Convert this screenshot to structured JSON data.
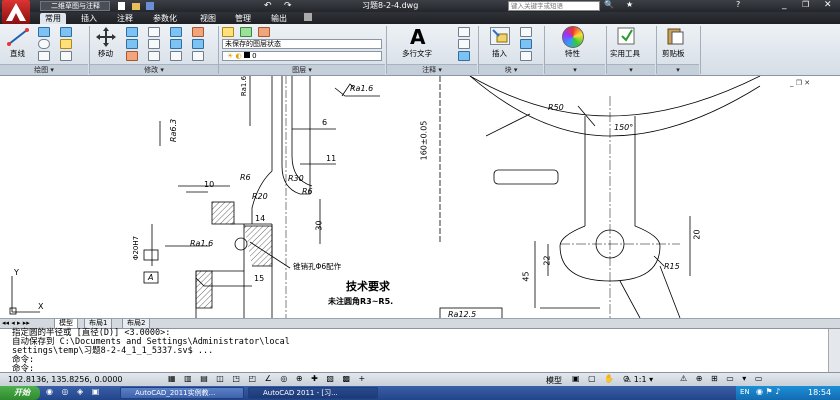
{
  "title_bar": {
    "workspace": "二维草图与注释",
    "file_title": "习题8-2-4.dwg",
    "search_placeholder": "键入关键字或短语"
  },
  "ribbon_tabs": [
    "常用",
    "插入",
    "注释",
    "参数化",
    "视图",
    "管理",
    "输出"
  ],
  "ribbon": {
    "draw_line_label": "直线",
    "draw_panel": "绘图",
    "modify_move_label": "移动",
    "modify_panel": "修改",
    "layer_state": "未保存的图层状态",
    "layer_current": "0",
    "layer_panel": "图层",
    "mtext_label": "多行文字",
    "annotation_panel": "注释",
    "insert_label": "插入",
    "block_panel": "块",
    "properties_label": "特性",
    "utilities_label": "实用工具",
    "clipboard_label": "剪贴板"
  },
  "drawing": {
    "dims": {
      "ra16_top": "Ra1.6",
      "ra16_top_right": "Ra1.6",
      "d6": "6",
      "d11": "11",
      "d160": "160±0.05",
      "ra63": "Ra6.3",
      "r6a": "R6",
      "r30": "R30",
      "r6b": "R6",
      "r20": "R20",
      "d10": "10",
      "d14": "14",
      "d30": "30",
      "phi20": "Φ20H7",
      "ra16_mid": "Ra1.6",
      "d15": "15",
      "taper_note": "锥销孔Φ6配作",
      "tech_title": "技术要求",
      "tech_note": "未注圆角R3~R5.",
      "ra125": "Ra12.5",
      "r50": "R50",
      "a150": "150°",
      "d20": "20",
      "d22": "22",
      "d45": "45",
      "r15": "R15",
      "datum_a": "A",
      "ucs_y": "Y",
      "ucs_x": "X"
    }
  },
  "layout_tabs": [
    "模型",
    "布局1",
    "布局2"
  ],
  "command_lines": [
    "指定圆的半径或 [直径(D)] <3.0000>:",
    "自动保存到 C:\\Documents and Settings\\Administrator\\local",
    "settings\\temp\\习题8-2-4_1_1_5337.sv$ ...",
    "命令:",
    "命令:"
  ],
  "status_bar": {
    "coords": "102.8136, 135.8256, 0.0000",
    "model_label": "模型",
    "scale": "1:1"
  },
  "taskbar": {
    "start": "开始",
    "task1": "AutoCAD_2011实例教...",
    "task2": "AutoCAD 2011 - [习...",
    "lang": "EN",
    "clock": "18:54"
  }
}
